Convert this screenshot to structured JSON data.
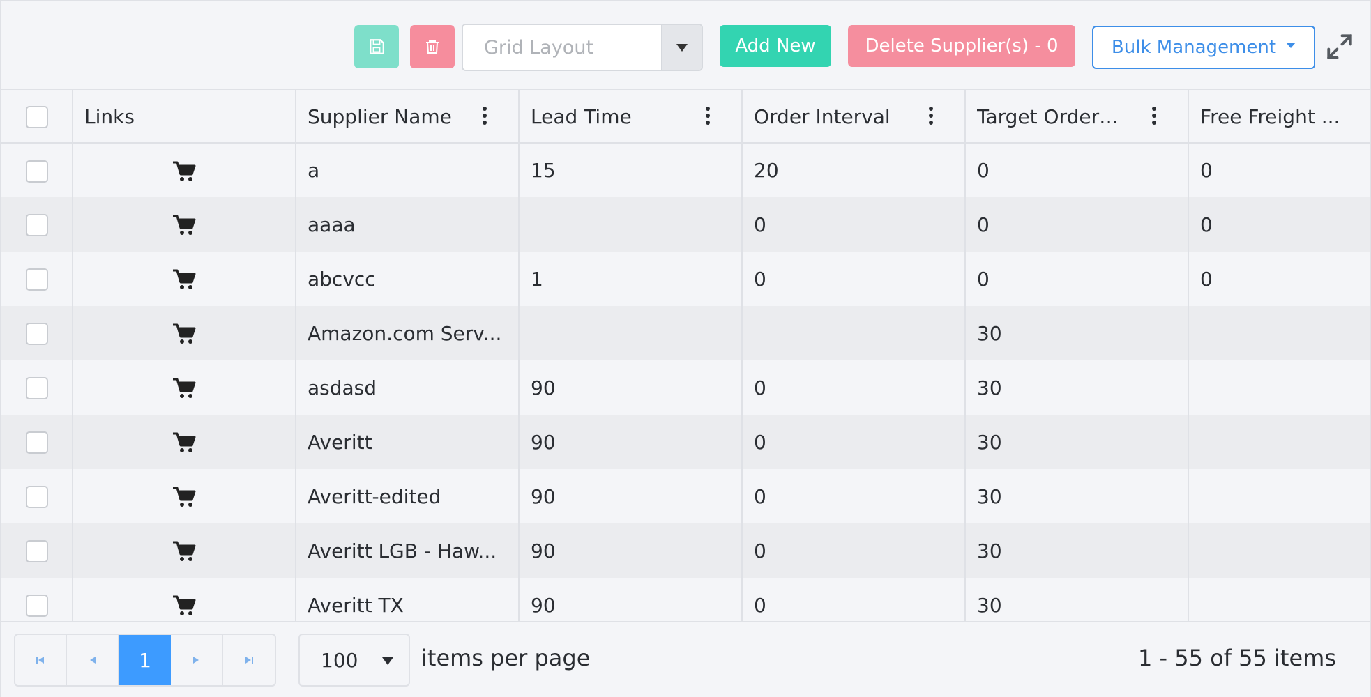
{
  "toolbar": {
    "grid_layout_placeholder": "Grid Layout",
    "add_new_label": "Add New",
    "delete_label": "Delete Supplier(s) - 0",
    "bulk_label": "Bulk Management",
    "colors": {
      "save": "#7edfca",
      "trash": "#f68d9d",
      "add": "#33d4b1",
      "delete": "#f58e9e",
      "bulk": "#3d8ee8"
    }
  },
  "grid": {
    "columns": [
      "Links",
      "Supplier Name",
      "Lead Time",
      "Order Interval",
      "Target Order ...",
      "Free Freight ..."
    ],
    "rows": [
      {
        "supplier": "a",
        "lead": "15",
        "interval": "20",
        "target": "0",
        "freight": "0"
      },
      {
        "supplier": "aaaa",
        "lead": "",
        "interval": "0",
        "target": "0",
        "freight": "0"
      },
      {
        "supplier": "abcvcc",
        "lead": "1",
        "interval": "0",
        "target": "0",
        "freight": "0"
      },
      {
        "supplier": "Amazon.com Serv...",
        "lead": "",
        "interval": "",
        "target": "30",
        "freight": ""
      },
      {
        "supplier": "asdasd",
        "lead": "90",
        "interval": "0",
        "target": "30",
        "freight": ""
      },
      {
        "supplier": "Averitt",
        "lead": "90",
        "interval": "0",
        "target": "30",
        "freight": ""
      },
      {
        "supplier": "Averitt-edited",
        "lead": "90",
        "interval": "0",
        "target": "30",
        "freight": ""
      },
      {
        "supplier": "Averitt LGB - Haw...",
        "lead": "90",
        "interval": "0",
        "target": "30",
        "freight": ""
      },
      {
        "supplier": "Averitt TX",
        "lead": "90",
        "interval": "0",
        "target": "30",
        "freight": ""
      }
    ]
  },
  "pager": {
    "current_page": "1",
    "page_size": "100",
    "per_page_label": "items per page",
    "info": "1 - 55 of 55 items"
  }
}
